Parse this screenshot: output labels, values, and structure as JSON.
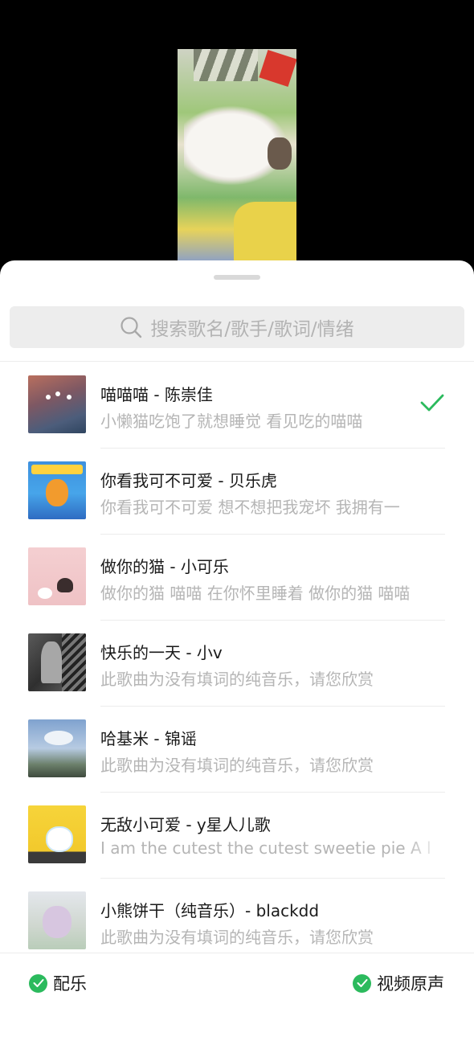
{
  "search": {
    "placeholder": "搜索歌名/歌手/歌词/情绪"
  },
  "songs": [
    {
      "title": "喵喵喵 - 陈崇佳",
      "lyric": "小懒猫吃饱了就想睡觉  看见吃的喵喵",
      "selected": true,
      "cover_color": "#8a5b55"
    },
    {
      "title": "你看我可不可爱 - 贝乐虎",
      "lyric": "你看我可不可爱  想不想把我宠坏  我拥有一",
      "selected": false,
      "cover_color": "#3f8fd8"
    },
    {
      "title": "做你的猫 - 小可乐",
      "lyric": "做你的猫 喵喵  在你怀里睡着  做你的猫 喵喵",
      "selected": false,
      "cover_color": "#f1c9cb"
    },
    {
      "title": "快乐的一天 - 小v",
      "lyric": "此歌曲为没有填词的纯音乐，请您欣赏",
      "selected": false,
      "cover_color": "#3b3b3b"
    },
    {
      "title": "哈基米 - 锦谣",
      "lyric": "此歌曲为没有填词的纯音乐，请您欣赏",
      "selected": false,
      "cover_color": "#8fb0d6"
    },
    {
      "title": "无敌小可爱 - y星人儿歌",
      "lyric": "I am the cutest the cutest sweetie pie  A l",
      "selected": false,
      "cover_color": "#f2cf33"
    },
    {
      "title": "小熊饼干（纯音乐）- blackdd",
      "lyric": "此歌曲为没有填词的纯音乐，请您欣赏",
      "selected": false,
      "cover_color": "#c9d5cf"
    }
  ],
  "options": {
    "music_label": "配乐",
    "original_sound_label": "视频原声"
  },
  "colors": {
    "accent": "#2bba5d"
  }
}
